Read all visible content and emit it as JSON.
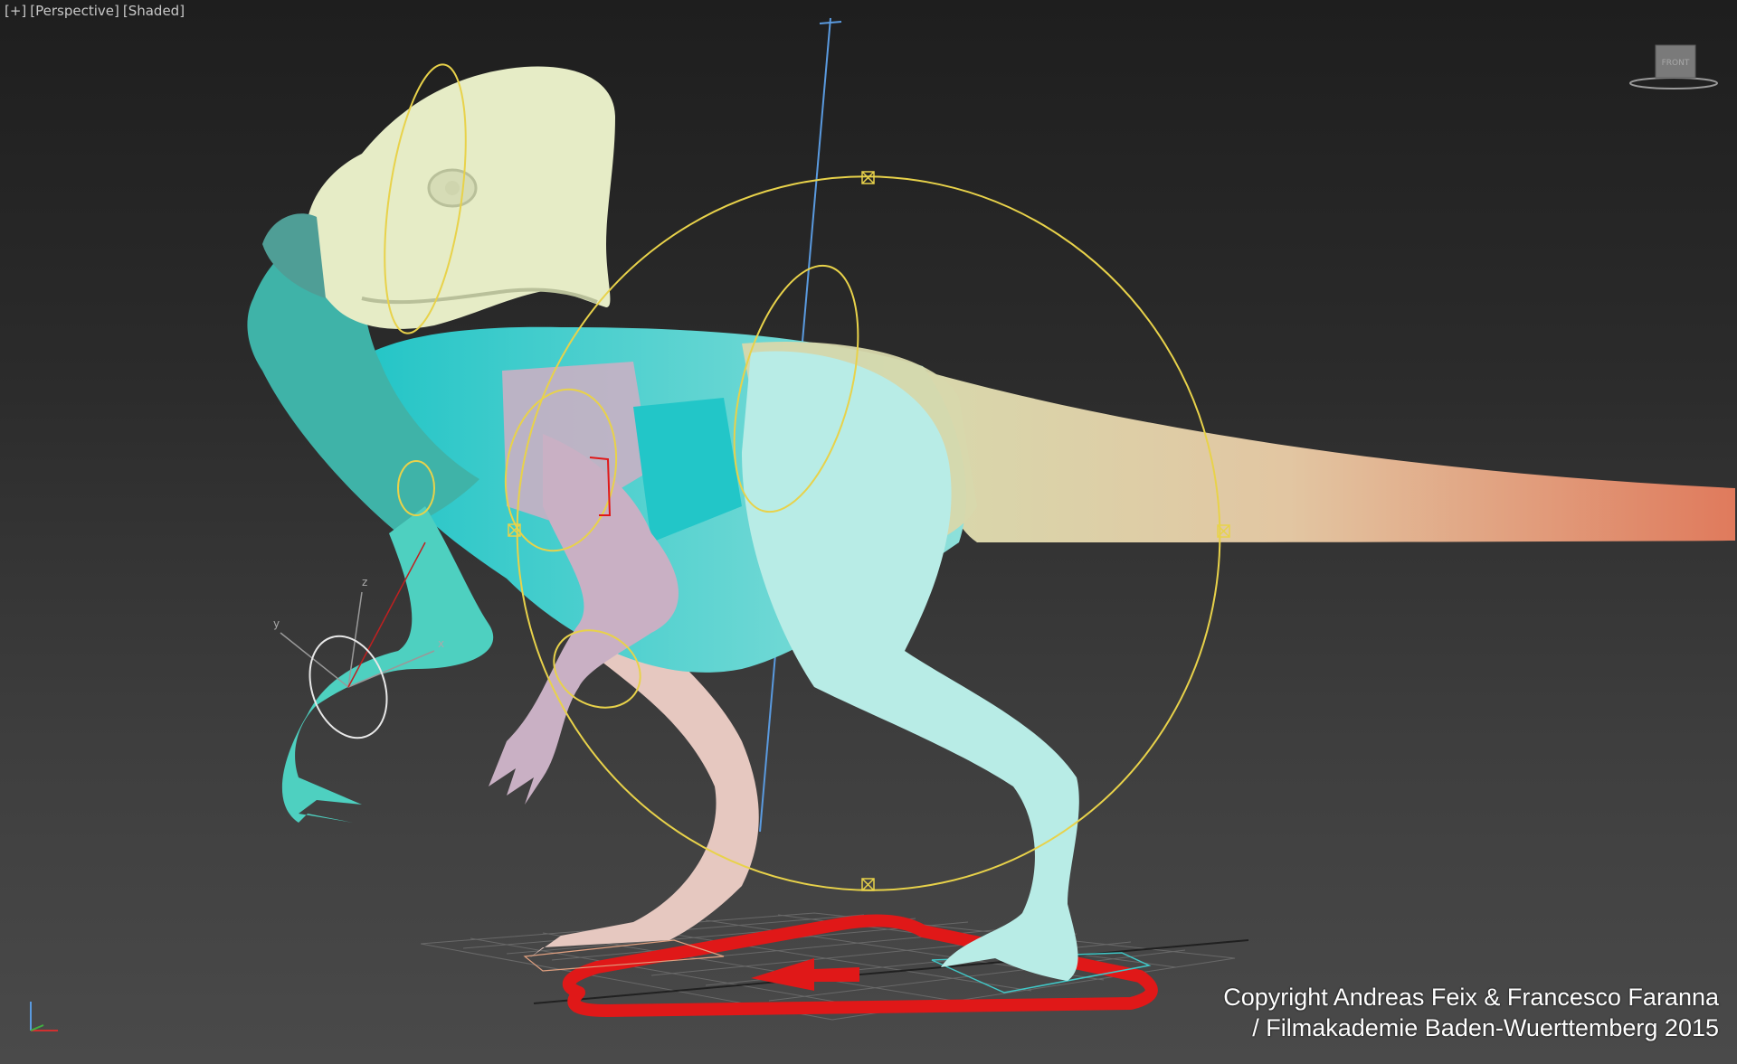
{
  "viewport": {
    "labels": [
      "[+]",
      "[Perspective]",
      "[Shaded]"
    ],
    "viewcube_face": "FRONT"
  },
  "copyright": {
    "line1": "Copyright Andreas Feix & Francesco Faranna",
    "line2": "/ Filmakademie Baden-Wuerttemberg 2015"
  },
  "gizmo_axes": {
    "x": "x",
    "y": "y",
    "z": "z"
  },
  "colors": {
    "control_curve": "#e8d24a",
    "ground_control": "#e01818",
    "z_axis_line": "#5a9adf",
    "head": "#e6ecc6",
    "neck_torso": "#20c8c8",
    "arm_pink": "#c9b0c4",
    "body_teal_light": "#b8ece6",
    "tail_start": "#d8d8ac",
    "tail_end": "#e08060"
  },
  "icons": [
    "viewcube-icon",
    "axis-tripod-icon",
    "transform-gizmo-icon"
  ]
}
